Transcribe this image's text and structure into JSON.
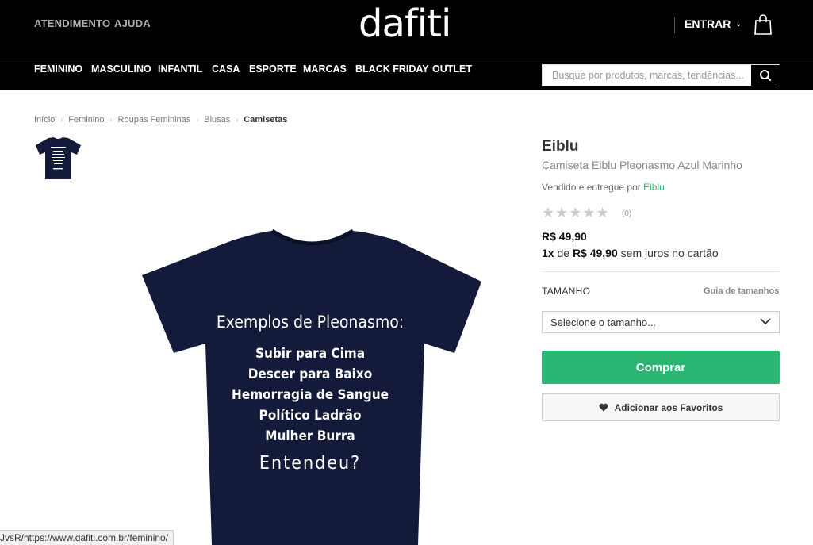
{
  "header": {
    "links": [
      {
        "label": "ATENDIMENTO"
      },
      {
        "label": "AJUDA"
      }
    ],
    "logo": "dafiti",
    "login_label": "ENTRAR",
    "login_chevron": "⌄",
    "cart_icon": "shopping-bag-icon"
  },
  "nav": {
    "items": [
      {
        "label": "FEMININO"
      },
      {
        "label": "MASCULINO"
      },
      {
        "label": "INFANTIL"
      },
      {
        "label": "CASA"
      },
      {
        "label": "ESPORTE"
      },
      {
        "label": "MARCAS"
      },
      {
        "label": "BLACK FRIDAY"
      },
      {
        "label": "OUTLET"
      }
    ],
    "search": {
      "placeholder": "Busque por produtos, marcas, tendências...",
      "value": "",
      "icon": "search-icon"
    }
  },
  "breadcrumb": {
    "items": [
      {
        "label": "Início"
      },
      {
        "label": "Feminino"
      },
      {
        "label": "Roupas Femininas"
      },
      {
        "label": "Blusas"
      }
    ],
    "current": "Camisetas",
    "separator": "›"
  },
  "product": {
    "brand": "Eiblu",
    "name": "Camiseta Eiblu Pleonasmo Azul Marinho",
    "sold_by_prefix": "Vendido e entregue por",
    "seller": "Eiblu",
    "stars": "★★★★★",
    "rating_count": "(0)",
    "price": "R$ 49,90",
    "installments": {
      "count": "1x",
      "word": "de",
      "amount": "R$ 49,90",
      "suffix": "sem juros no cartão"
    },
    "shirt_text": {
      "heading": "Exemplos de Pleonasmo:",
      "lines": [
        "Subir para Cima",
        "Descer para Baixo",
        "Hemorragia de Sangue",
        "Político Ladrão",
        "Mulher Burra"
      ],
      "closing": "Entendeu?"
    },
    "shirt_color": "#141b3a",
    "size_label": "TAMANHO",
    "size_guide": "Guia de tamanhos",
    "size_select": "Selecione o tamanho...",
    "buy_label": "Comprar",
    "favorite_label": "Adicionar aos Favoritos",
    "buy_color": "#2bb673"
  },
  "status_bar": {
    "url": "JvsR/https://www.dafiti.com.br/feminino/"
  }
}
